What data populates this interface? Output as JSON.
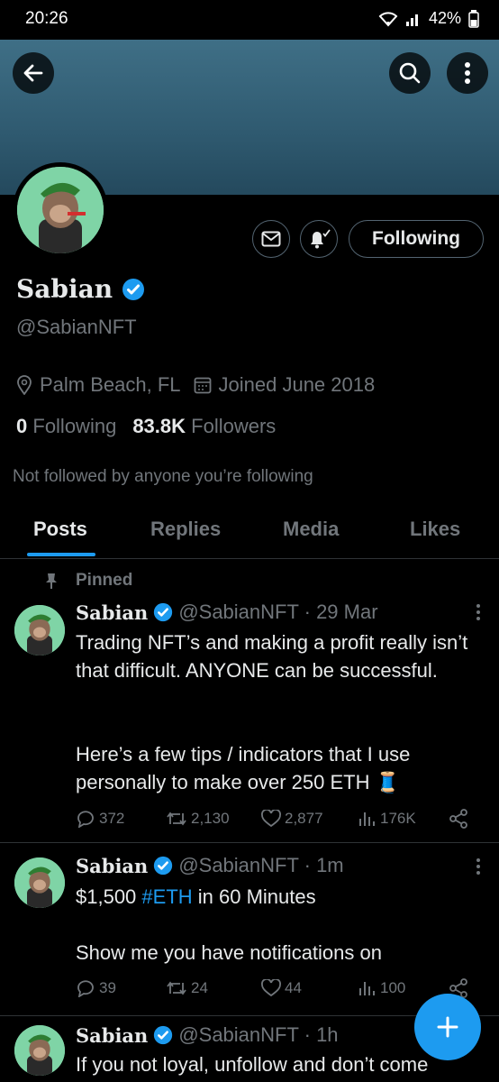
{
  "status_bar": {
    "time": "20:26",
    "battery": "42%"
  },
  "profile": {
    "name": "Sabian",
    "handle": "@SabianNFT",
    "location": "Palm Beach, FL",
    "joined": "Joined June 2018",
    "following_count": "0",
    "following_label": "Following",
    "followers_count": "83.8K",
    "followers_label": "Followers",
    "not_followed_text": "Not followed by anyone you’re following",
    "follow_button": "Following"
  },
  "tabs": [
    {
      "label": "Posts",
      "active": true
    },
    {
      "label": "Replies",
      "active": false
    },
    {
      "label": "Media",
      "active": false
    },
    {
      "label": "Likes",
      "active": false
    }
  ],
  "tweets": [
    {
      "pinned_label": "Pinned",
      "name": "Sabian",
      "handle_time": "@SabianNFT · 29 Mar",
      "text_1": "Trading NFT’s and making a profit really isn’t that difficult. ANYONE can be successful.",
      "text_2": "Here’s a few tips / indicators that I use personally to make over 250 ETH 🧵",
      "replies": "372",
      "retweets": "2,130",
      "likes": "2,877",
      "views": "176K"
    },
    {
      "name": "Sabian",
      "handle_time": "@SabianNFT · 1m",
      "text_pre": "$1,500 ",
      "hashtag": "#ETH",
      "text_post": " in 60 Minutes",
      "text_2": "Show me you have notifications on",
      "replies": "39",
      "retweets": "24",
      "likes": "44",
      "views": "100"
    },
    {
      "name": "Sabian",
      "handle_time": "@SabianNFT · 1h",
      "text_1": "If you not loyal, unfollow and don’t come"
    }
  ],
  "colors": {
    "accent": "#1d9bf0",
    "muted": "#71767b",
    "background": "#000000",
    "banner": "#3f6f86"
  }
}
